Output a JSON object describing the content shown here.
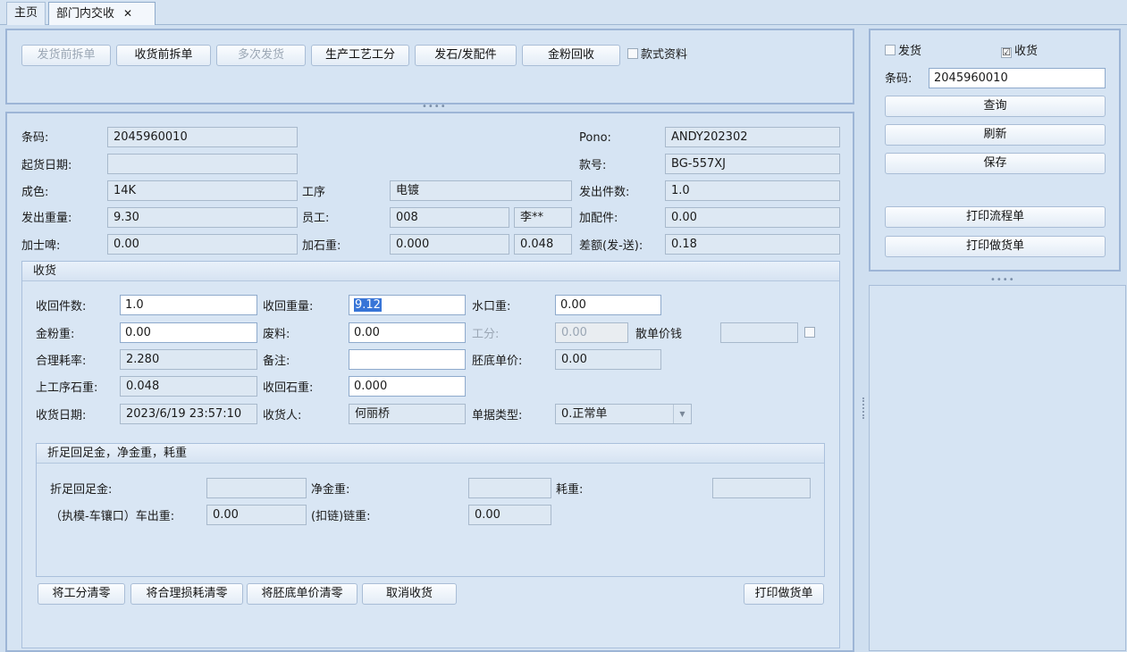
{
  "tabs": {
    "home": "主页",
    "active": "部门内交收",
    "close": "✕"
  },
  "toolbar": {
    "btn_before_ship_split": "发货前拆单",
    "btn_before_recv_split": "收货前拆单",
    "btn_multi_ship": "多次发货",
    "btn_process_labor": "生产工艺工分",
    "btn_stone_parts": "发石/发配件",
    "btn_gold_powder": "金粉回收",
    "style_info_label": "款式资料"
  },
  "info": {
    "barcode_label": "条码:",
    "barcode": "2045960010",
    "start_date_label": "起货日期:",
    "start_date": "",
    "purity_label": "成色:",
    "purity": "14K",
    "process_label": "工序",
    "process": "电镀",
    "out_weight_label": "发出重量:",
    "out_weight": "9.30",
    "employee_label": "员工:",
    "employee_id": "008",
    "employee_name": "李**",
    "karat_label": "加士啤:",
    "karat": "0.00",
    "stone_weight_label": "加石重:",
    "stone_weight": "0.000",
    "stone_weight2": "0.048",
    "pono_label": "Pono:",
    "pono": "ANDY202302",
    "style_no_label": "款号:",
    "style_no": "BG-557XJ",
    "out_pcs_label": "发出件数:",
    "out_pcs": "1.0",
    "parts_label": "加配件:",
    "parts": "0.00",
    "diff_label": "差额(发-送):",
    "diff": "0.18"
  },
  "receive": {
    "title": "收货",
    "recv_pcs_label": "收回件数:",
    "recv_pcs": "1.0",
    "recv_weight_label": "收回重量:",
    "recv_weight": "9.12",
    "water_label": "水口重:",
    "water": "0.00",
    "gold_powder_label": "金粉重:",
    "gold_powder": "0.00",
    "scrap_label": "废料:",
    "scrap": "0.00",
    "labor_label": "工分:",
    "labor": "0.00",
    "piece_price_label": "散单价钱",
    "piece_price": "",
    "loss_rate_label": "合理耗率:",
    "loss_rate": "2.280",
    "remark_label": "备注:",
    "remark": "",
    "blank_price_label": "胚底单价:",
    "blank_price": "0.00",
    "prev_stone_label": "上工序石重:",
    "prev_stone": "0.048",
    "recv_stone_label": "收回石重:",
    "recv_stone": "0.000",
    "recv_date_label": "收货日期:",
    "recv_date": "2023/6/19 23:57:10",
    "receiver_label": "收货人:",
    "receiver": "何丽桥",
    "doc_type_label": "单据类型:",
    "doc_type": "0.正常单"
  },
  "calc": {
    "title": "折足回足金，净金重，耗重",
    "fine_gold_label": "折足回足金:",
    "fine_gold": "",
    "net_gold_label": "净金重:",
    "net_gold": "",
    "loss_weight_label": "耗重:",
    "loss_weight": "",
    "mold_label": "（执模-车镶口）车出重:",
    "mold": "0.00",
    "chain_label": "(扣链)链重:",
    "chain": "0.00"
  },
  "bottom": {
    "btn_clear_labor": "将工分清零",
    "btn_clear_loss": "将合理损耗清零",
    "btn_clear_blank": "将胚底单价清零",
    "btn_cancel_recv": "取消收货",
    "btn_print_doc": "打印做货单"
  },
  "side": {
    "ship_label": "发货",
    "recv_label": "收货",
    "recv_check": "☑",
    "barcode_label": "条码:",
    "barcode": "2045960010",
    "btn_query": "查询",
    "btn_refresh": "刷新",
    "btn_save": "保存",
    "btn_print_flow": "打印流程单",
    "btn_print_doc": "打印做货单"
  }
}
